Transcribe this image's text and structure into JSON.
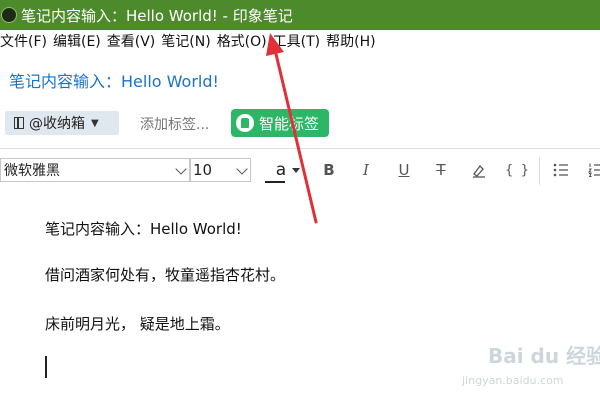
{
  "window": {
    "title": "笔记内容输入：Hello World! - 印象笔记"
  },
  "menu": [
    "文件(F)",
    "编辑(E)",
    "查看(V)",
    "笔记(N)",
    "格式(O)",
    "工具(T)",
    "帮助(H)"
  ],
  "note": {
    "title": "笔记内容输入：Hello World!",
    "notebook": "@收纳箱",
    "add_tag_placeholder": "添加标签...",
    "smart_tag_label": "智能标签"
  },
  "toolbar": {
    "font_family": "微软雅黑",
    "font_size": "10",
    "font_color_letter": "a",
    "bold": "B",
    "italic": "I",
    "underline": "U",
    "strike": "T",
    "code": "{ }"
  },
  "body": {
    "paragraphs": [
      "笔记内容输入：Hello World!",
      "借问酒家何处有，牧童遥指杏花村。",
      "床前明月光， 疑是地上霜。"
    ]
  },
  "watermark": {
    "brand": "Bai du 经验",
    "url": "jingyan.baidu.com"
  },
  "colors": {
    "titlebar": "#4d8a2b",
    "note_title": "#1b73c8",
    "smart_tag": "#2db665",
    "annotation_arrow": "#e0303a"
  }
}
